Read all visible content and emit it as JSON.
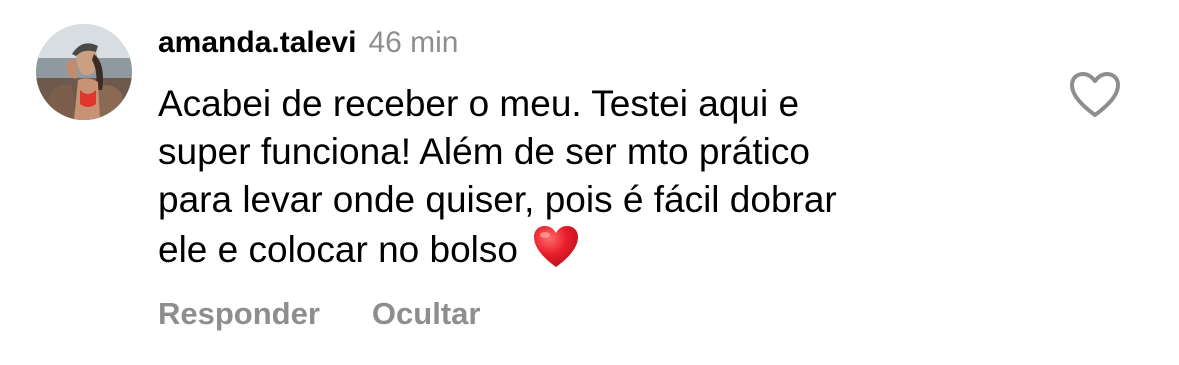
{
  "comment": {
    "username": "amanda.talevi",
    "timestamp": "46 min",
    "text_lines": [
      "Acabei de receber o meu. Testei aqui e",
      "super funciona! Além de ser mto prático",
      "para levar onde quiser, pois é fácil dobrar",
      "ele e colocar no bolso"
    ],
    "emoji": "red-heart-emoji",
    "like_icon": "heart-outline-icon",
    "avatar": "avatar-photo"
  },
  "actions": {
    "reply_label": "Responder",
    "hide_label": "Ocultar"
  },
  "colors": {
    "text": "#000000",
    "secondary": "#8e8e8e",
    "heart_emoji": "#e0202a",
    "background": "#ffffff"
  }
}
